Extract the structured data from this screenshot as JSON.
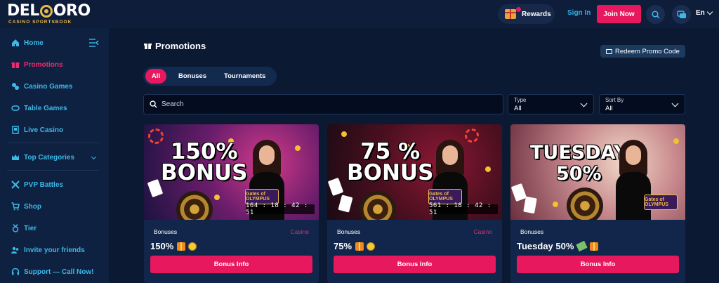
{
  "header": {
    "logo_text": "DEL ORO",
    "logo_sub": "CASINO   SPORTSBOOK",
    "rewards_label": "Rewards",
    "signin_label": "Sign In",
    "join_label": "Join Now",
    "language": "En"
  },
  "sidebar": {
    "items": [
      {
        "label": "Home",
        "icon": "home-icon"
      },
      {
        "label": "Promotions",
        "icon": "gift-icon"
      },
      {
        "label": "Casino Games",
        "icon": "casino-chips-icon"
      },
      {
        "label": "Table Games",
        "icon": "table-icon"
      },
      {
        "label": "Live Casino",
        "icon": "dealer-icon"
      },
      {
        "label": "Top Categories",
        "icon": "crown-icon"
      },
      {
        "label": "PVP Battles",
        "icon": "swords-icon"
      },
      {
        "label": "Shop",
        "icon": "cart-icon"
      },
      {
        "label": "Tier",
        "icon": "medal-icon"
      },
      {
        "label": "Invite your friends",
        "icon": "users-icon"
      },
      {
        "label": "Support — Call Now!",
        "icon": "headset-icon"
      }
    ],
    "active_color": "#ee2a6d",
    "item_color": "#3db8e8"
  },
  "main": {
    "title": "Promotions",
    "redeem_label": "Redeem Promo Code",
    "tabs": [
      {
        "label": "All",
        "active": true
      },
      {
        "label": "Bonuses",
        "active": false
      },
      {
        "label": "Tournaments",
        "active": false
      }
    ],
    "search_placeholder": "Search",
    "type_filter": {
      "label": "Type",
      "value": "All"
    },
    "sort_filter": {
      "label": "Sort By",
      "value": "All"
    }
  },
  "cards": [
    {
      "banner_line1": "150%",
      "banner_line2": "BONUS",
      "timer": "164 : 18 : 42 : 51",
      "category": "Bonuses",
      "tag": "Casino",
      "title": "150%",
      "button": "Bonus Info",
      "badge": "Gates of OLYMPUS"
    },
    {
      "banner_line1": "75 %",
      "banner_line2": "BONUS",
      "timer": "561 : 18 : 42 : 51",
      "category": "Bonuses",
      "tag": "Casino",
      "title": "75%",
      "button": "Bonus Info",
      "badge": "Gates of OLYMPUS"
    },
    {
      "banner_line1": "TUESDAY",
      "banner_line2": "50%",
      "category": "Bonuses",
      "title": "Tuesday 50%",
      "button": "Bonus Info",
      "badge": "Gates of OLYMPUS"
    }
  ],
  "colors": {
    "accent": "#e8185f",
    "background": "#0b1933",
    "panel": "#11264a"
  }
}
